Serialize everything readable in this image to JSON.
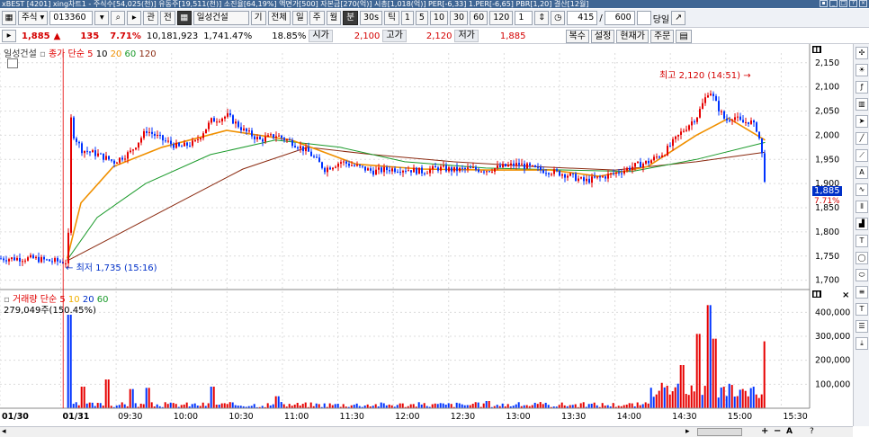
{
  "titlebar": {
    "text": "xBEST  [4201] xing차트1 - 주식수[54,025(천)] 유동주[19,511(천)] 소진율[64,19%] 액면가[500] 자본금[270(억)] 시총[1,018(억)] PER[-6,33] 1.PER[-6,65] PBR[1,20] 결산[12월]"
  },
  "toolbar": {
    "type_select": "주식",
    "code": "013360",
    "btn_gwan": "관",
    "btn_jeon": "전",
    "stock_name": "일성건설",
    "btn_gi": "기",
    "btn_all": "전체",
    "periods": [
      "일",
      "주",
      "월",
      "분",
      "30s",
      "틱"
    ],
    "minutes": [
      "1",
      "5",
      "10",
      "30",
      "60",
      "120"
    ],
    "spin_value": "1",
    "count_value": "415",
    "count_total": "600",
    "today_label": "당일"
  },
  "infobar": {
    "price": "1,885",
    "arrow": "▲",
    "change": "135",
    "change_pct": "7.71%",
    "volume": "10,181,923",
    "vol_pct": "1,741.47%",
    "turnover": "18.85%",
    "open_label": "시가",
    "open": "2,100",
    "high_label": "고가",
    "high": "2,120",
    "low_label": "저가",
    "low": "1,885",
    "buttons": [
      "복수",
      "설정",
      "현재가",
      "주문"
    ]
  },
  "price_panel": {
    "legend_name": "일성건설",
    "legend_ma": "종가 단순",
    "legend_periods": [
      "5",
      "10",
      "20",
      "60",
      "120"
    ],
    "high_note": "최고 2,120 (14:51)",
    "low_note": "최저 1,735 (15:16)",
    "current_tag": "1,885",
    "current_pct": "7.71%"
  },
  "volume_panel": {
    "legend_name": "거래량",
    "legend_ma": "단순",
    "legend_periods": [
      "5",
      "10",
      "20",
      "60"
    ],
    "current": "279,049주(150.45%)"
  },
  "colors": {
    "up": "#e60000",
    "down": "#0033ff",
    "ma5": "#e00000",
    "ma10": "#000000",
    "ma20": "#f09000",
    "ma60": "#1a9a2a",
    "ma120": "#8b2a10"
  },
  "chart_data": {
    "type": "candlestick",
    "price_axis": {
      "ticks": [
        2150,
        2100,
        2050,
        2000,
        1950,
        1900,
        1850,
        1800,
        1750,
        1700
      ],
      "range": [
        1690,
        2170
      ]
    },
    "volume_axis": {
      "ticks": [
        "400,000",
        "300,000",
        "200,000",
        "100,000"
      ],
      "values": [
        400000,
        300000,
        200000,
        100000
      ],
      "range": [
        0,
        450000
      ]
    },
    "time_labels": [
      "01/30",
      "01/31",
      "09:30",
      "10:00",
      "10:30",
      "11:00",
      "11:30",
      "12:00",
      "12:30",
      "13:00",
      "13:30",
      "14:00",
      "14:30",
      "15:00",
      "15:30"
    ],
    "price_path": [
      [
        0,
        1745
      ],
      [
        0.04,
        1745
      ],
      [
        0.06,
        1740
      ],
      [
        0.08,
        1738
      ],
      [
        0.083,
        1740
      ],
      [
        0.085,
        2050
      ],
      [
        0.09,
        2000
      ],
      [
        0.1,
        1970
      ],
      [
        0.12,
        1960
      ],
      [
        0.14,
        1945
      ],
      [
        0.16,
        1965
      ],
      [
        0.18,
        2010
      ],
      [
        0.2,
        1990
      ],
      [
        0.22,
        1975
      ],
      [
        0.24,
        1985
      ],
      [
        0.26,
        2030
      ],
      [
        0.28,
        2040
      ],
      [
        0.3,
        2010
      ],
      [
        0.32,
        1990
      ],
      [
        0.34,
        2000
      ],
      [
        0.36,
        1985
      ],
      [
        0.38,
        1965
      ],
      [
        0.4,
        1930
      ],
      [
        0.42,
        1945
      ],
      [
        0.44,
        1935
      ],
      [
        0.46,
        1925
      ],
      [
        0.48,
        1930
      ],
      [
        0.5,
        1930
      ],
      [
        0.52,
        1925
      ],
      [
        0.54,
        1932
      ],
      [
        0.56,
        1928
      ],
      [
        0.58,
        1930
      ],
      [
        0.6,
        1928
      ],
      [
        0.62,
        1935
      ],
      [
        0.64,
        1940
      ],
      [
        0.66,
        1930
      ],
      [
        0.68,
        1925
      ],
      [
        0.7,
        1918
      ],
      [
        0.72,
        1905
      ],
      [
        0.74,
        1912
      ],
      [
        0.76,
        1922
      ],
      [
        0.78,
        1935
      ],
      [
        0.8,
        1945
      ],
      [
        0.82,
        1965
      ],
      [
        0.84,
        2005
      ],
      [
        0.86,
        2040
      ],
      [
        0.875,
        2095
      ],
      [
        0.885,
        2060
      ],
      [
        0.895,
        2030
      ],
      [
        0.905,
        2040
      ],
      [
        0.915,
        2025
      ],
      [
        0.925,
        2030
      ],
      [
        0.935,
        2010
      ],
      [
        0.94,
        1960
      ],
      [
        0.945,
        1885
      ]
    ],
    "ma_paths": {
      "ma20": [
        [
          0.083,
          1745
        ],
        [
          0.1,
          1860
        ],
        [
          0.14,
          1935
        ],
        [
          0.2,
          1975
        ],
        [
          0.28,
          2010
        ],
        [
          0.36,
          1990
        ],
        [
          0.44,
          1940
        ],
        [
          0.52,
          1930
        ],
        [
          0.6,
          1928
        ],
        [
          0.68,
          1928
        ],
        [
          0.74,
          1915
        ],
        [
          0.8,
          1935
        ],
        [
          0.86,
          2000
        ],
        [
          0.9,
          2035
        ],
        [
          0.945,
          1990
        ]
      ],
      "ma60": [
        [
          0.083,
          1742
        ],
        [
          0.12,
          1830
        ],
        [
          0.18,
          1900
        ],
        [
          0.26,
          1960
        ],
        [
          0.34,
          1990
        ],
        [
          0.42,
          1975
        ],
        [
          0.5,
          1945
        ],
        [
          0.6,
          1932
        ],
        [
          0.7,
          1928
        ],
        [
          0.78,
          1925
        ],
        [
          0.86,
          1950
        ],
        [
          0.945,
          1985
        ]
      ],
      "ma120": [
        [
          0.083,
          1740
        ],
        [
          0.14,
          1790
        ],
        [
          0.22,
          1860
        ],
        [
          0.3,
          1930
        ],
        [
          0.38,
          1975
        ],
        [
          0.46,
          1960
        ],
        [
          0.56,
          1945
        ],
        [
          0.66,
          1935
        ],
        [
          0.76,
          1928
        ],
        [
          0.86,
          1945
        ],
        [
          0.945,
          1965
        ]
      ]
    },
    "volume_bars": {
      "x_start": 0.083,
      "x_end": 0.945,
      "spikes": [
        [
          0.083,
          390000
        ],
        [
          0.1,
          90000
        ],
        [
          0.13,
          120000
        ],
        [
          0.16,
          80000
        ],
        [
          0.18,
          85000
        ],
        [
          0.26,
          90000
        ],
        [
          0.34,
          50000
        ],
        [
          0.6,
          30000
        ],
        [
          0.84,
          180000
        ],
        [
          0.86,
          310000
        ],
        [
          0.875,
          430000
        ],
        [
          0.88,
          290000
        ],
        [
          0.945,
          279049
        ]
      ]
    }
  }
}
